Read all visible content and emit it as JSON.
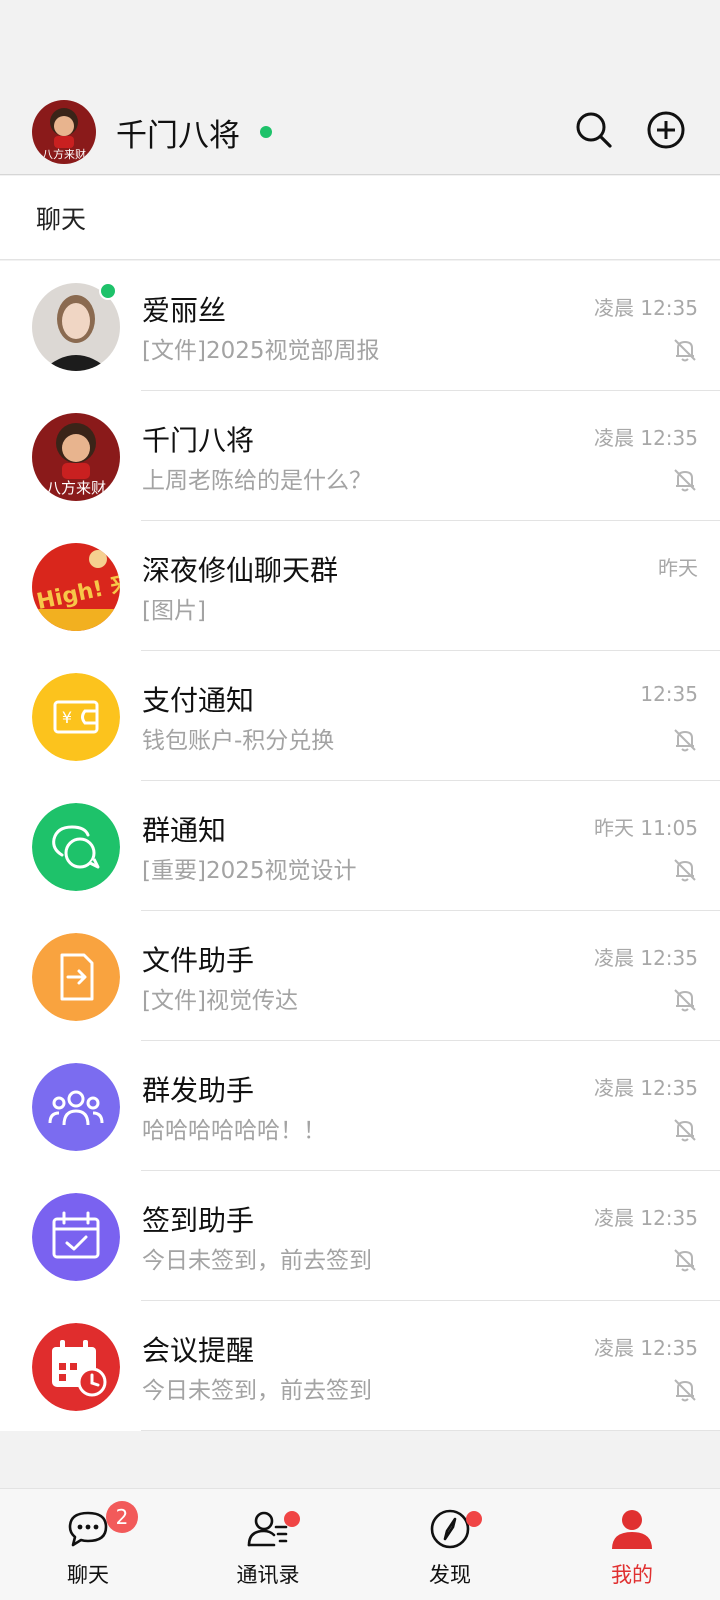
{
  "header": {
    "title": "千门八将",
    "avatar_text": "八方来财",
    "icons": [
      "search-icon",
      "add-circle-icon"
    ]
  },
  "section": {
    "label": "聊天"
  },
  "colors": {
    "online": "#1ec26a",
    "badge": "#f25a5a",
    "active_tab": "#e03030",
    "payment": "#fcc31d",
    "group_notice": "#1ec26a",
    "file_helper": "#f9a33f",
    "broadcast": "#7b6cf0",
    "checkin": "#7a62f0",
    "meeting": "#e02d2d"
  },
  "chats": [
    {
      "name": "爱丽丝",
      "preview": "[文件]2025视觉部周报",
      "time": "凌晨 12:35",
      "online": true,
      "muted": true,
      "avatar": "user-photo"
    },
    {
      "name": "千门八将",
      "preview": "上周老陈给的是什么？",
      "time": "凌晨 12:35",
      "muted": true,
      "avatar": "cartoon-avatar",
      "avatar_text": "八方来财"
    },
    {
      "name": "深夜修仙聊天群",
      "preview": "[图片]",
      "time": "昨天",
      "muted": false,
      "avatar": "group-poster",
      "avatar_text": "High! 来"
    },
    {
      "name": "支付通知",
      "preview": "钱包账户-积分兑换",
      "time": "12:35",
      "muted": true,
      "avatar": "wallet-icon"
    },
    {
      "name": "群通知",
      "preview": "[重要]2025视觉设计",
      "time": "昨天 11:05",
      "muted": true,
      "avatar": "chat-bubbles-icon"
    },
    {
      "name": "文件助手",
      "preview": "[文件]视觉传达",
      "time": "凌晨 12:35",
      "muted": true,
      "avatar": "file-transfer-icon"
    },
    {
      "name": "群发助手",
      "preview": "哈哈哈哈哈哈！！",
      "time": "凌晨 12:35",
      "muted": true,
      "avatar": "people-group-icon"
    },
    {
      "name": "签到助手",
      "preview": "今日未签到，前去签到",
      "time": "凌晨 12:35",
      "muted": true,
      "avatar": "calendar-check-icon"
    },
    {
      "name": "会议提醒",
      "preview": "今日未签到，前去签到",
      "time": "凌晨 12:35",
      "muted": true,
      "avatar": "calendar-clock-icon"
    }
  ],
  "tabs": [
    {
      "label": "聊天",
      "icon": "chat-bubble-icon",
      "badge": "2"
    },
    {
      "label": "通讯录",
      "icon": "contacts-icon",
      "dot": true
    },
    {
      "label": "发现",
      "icon": "compass-icon",
      "dot": true
    },
    {
      "label": "我的",
      "icon": "profile-icon",
      "active": true
    }
  ]
}
